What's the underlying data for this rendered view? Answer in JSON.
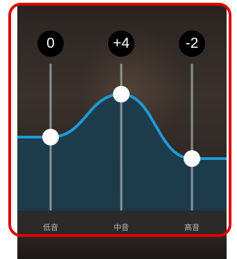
{
  "equalizer": {
    "colors": {
      "curve": "#1e9ad6",
      "fill": "#1c3d4e",
      "track": "#9aa4a8",
      "knob": "#ffffff",
      "badge": "#000000",
      "frame": "#e10000"
    },
    "bands": [
      {
        "label": "低音",
        "value_text": "0",
        "gain": 0
      },
      {
        "label": "中音",
        "value_text": "+4",
        "gain": 4
      },
      {
        "label": "高音",
        "value_text": "-2",
        "gain": -2
      }
    ]
  }
}
